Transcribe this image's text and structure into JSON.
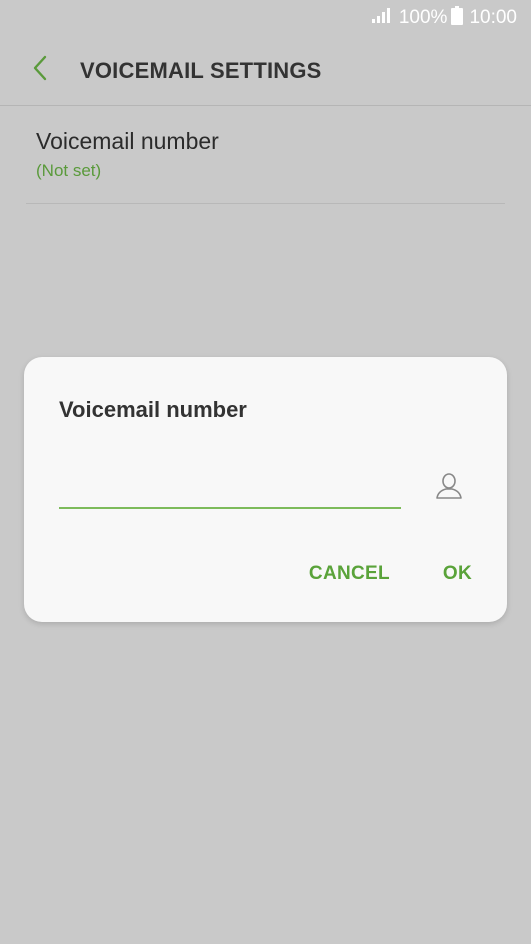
{
  "status_bar": {
    "battery_percent": "100%",
    "time": "10:00",
    "icons": [
      "signal-icon",
      "battery-icon"
    ]
  },
  "header": {
    "title": "VOICEMAIL SETTINGS",
    "back_icon": "chevron-left-icon"
  },
  "setting": {
    "label": "Voicemail number",
    "value": "(Not set)"
  },
  "dialog": {
    "title": "Voicemail number",
    "input_value": "",
    "contact_icon": "contact-person-icon",
    "cancel_label": "CANCEL",
    "ok_label": "OK"
  },
  "colors": {
    "accent": "#5aa33a",
    "input_underline": "#7dbb5b",
    "background_dim": "#c9c9c9",
    "dialog_bg": "#f8f8f8"
  }
}
